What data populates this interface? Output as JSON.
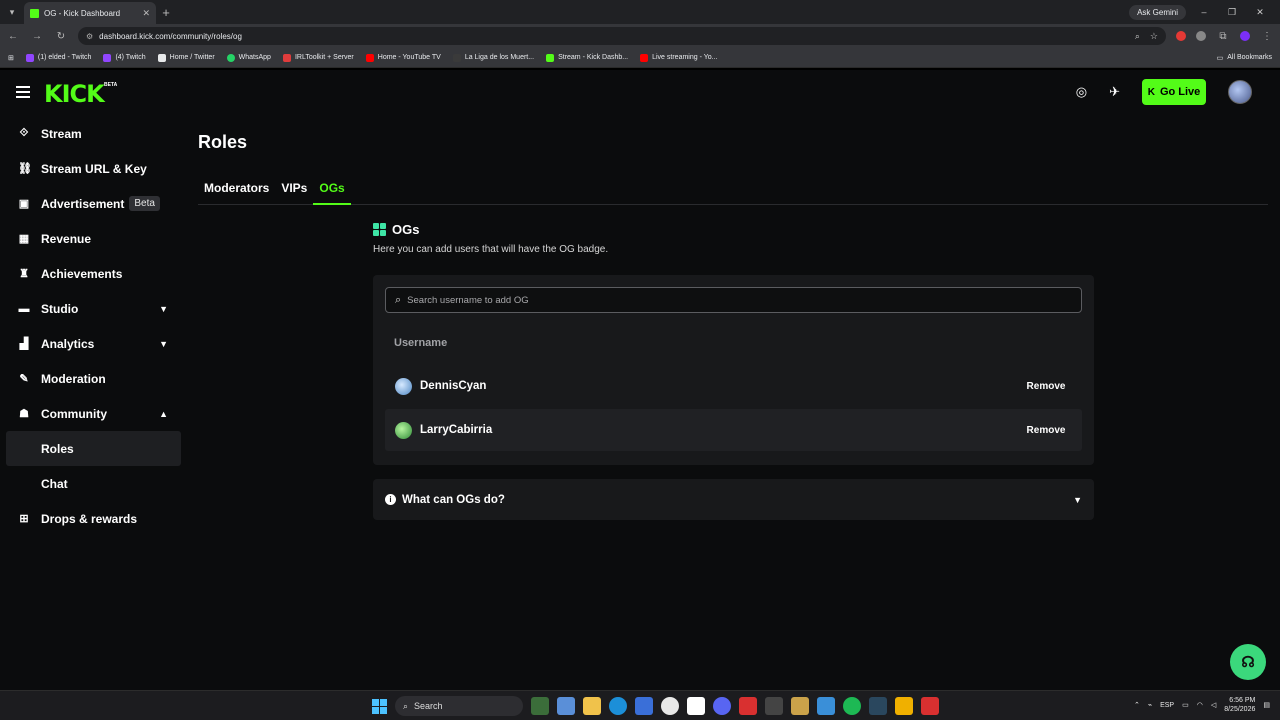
{
  "browser": {
    "tab_title": "OG - Kick Dashboard",
    "url": "dashboard.kick.com/community/roles/og",
    "gemini_label": "Ask Gemini",
    "bookmarks": [
      {
        "label": "(1) elded - Twitch",
        "color": "#9146ff"
      },
      {
        "label": "(4) Twitch",
        "color": "#9146ff"
      },
      {
        "label": "Home / Twitter",
        "color": "#e7e9ea"
      },
      {
        "label": "WhatsApp",
        "color": "#25d366"
      },
      {
        "label": "IRLToolkit + Server",
        "color": "#e03c3c"
      },
      {
        "label": "Home - YouTube TV",
        "color": "#ff0000"
      },
      {
        "label": "La Liga de los Muert...",
        "color": "#3a3a3a"
      },
      {
        "label": "Stream - Kick Dashb...",
        "color": "#53fc18"
      },
      {
        "label": "Live streaming - Yo...",
        "color": "#ff0000"
      }
    ],
    "all_bookmarks": "All Bookmarks"
  },
  "header": {
    "logo": "KICK",
    "logo_badge": "BETA",
    "go_live": "Go Live",
    "accent": "#53fc18"
  },
  "sidebar": {
    "items": [
      {
        "label": "Stream",
        "icon": "broadcast-icon"
      },
      {
        "label": "Stream URL & Key",
        "icon": "link-icon"
      },
      {
        "label": "Advertisement",
        "icon": "ad-icon",
        "badge": "Beta"
      },
      {
        "label": "Revenue",
        "icon": "revenue-icon"
      },
      {
        "label": "Achievements",
        "icon": "trophy-icon"
      },
      {
        "label": "Studio",
        "icon": "studio-icon",
        "expandable": true
      },
      {
        "label": "Analytics",
        "icon": "analytics-icon",
        "expandable": true
      },
      {
        "label": "Moderation",
        "icon": "wrench-icon"
      },
      {
        "label": "Community",
        "icon": "community-icon",
        "expanded": true
      }
    ],
    "community_sub": [
      {
        "label": "Roles",
        "active": true
      },
      {
        "label": "Chat",
        "active": false
      }
    ],
    "drops": {
      "label": "Drops & rewards",
      "icon": "gift-icon"
    }
  },
  "main": {
    "title": "Roles",
    "tabs": [
      {
        "label": "Moderators",
        "active": false
      },
      {
        "label": "VIPs",
        "active": false
      },
      {
        "label": "OGs",
        "active": true
      }
    ],
    "section_title": "OGs",
    "section_desc": "Here you can add users that will have the OG badge.",
    "search_placeholder": "Search username to add OG",
    "column_header": "Username",
    "users": [
      {
        "name": "DennisCyan",
        "avatar_color": "#7fb2e6"
      },
      {
        "name": "LarryCabirria",
        "avatar_color": "#3fb94a"
      }
    ],
    "remove_label": "Remove",
    "faq_title": "What can OGs do?"
  },
  "taskbar": {
    "search": "Search",
    "lang": "ESP",
    "time": "6:56 PM",
    "date": "8/25/2026"
  }
}
